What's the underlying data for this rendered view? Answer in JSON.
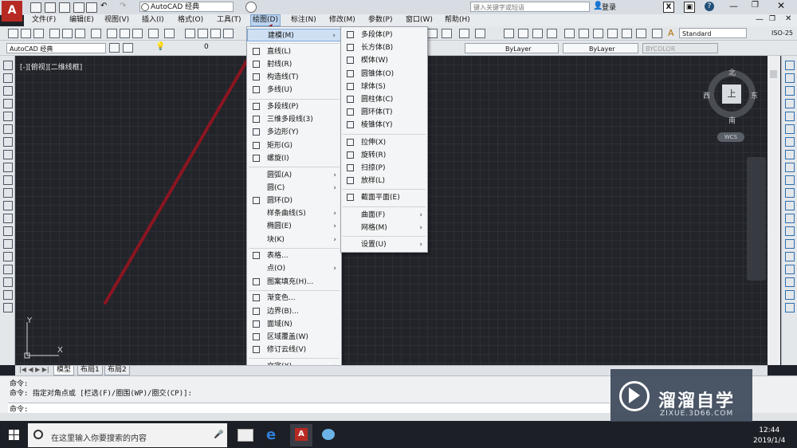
{
  "title_bar": {
    "workspace": "AutoCAD 经典",
    "search_placeholder": "键入关键字或短语",
    "login": "登录"
  },
  "menubar": [
    "文件(F)",
    "编辑(E)",
    "视图(V)",
    "插入(I)",
    "格式(O)",
    "工具(T)",
    "绘图(D)",
    "标注(N)",
    "修改(M)",
    "参数(P)",
    "窗口(W)",
    "帮助(H)"
  ],
  "toolbar2": {
    "workspace": "AutoCAD 经典",
    "layer": "0",
    "bylayer_color": "ByLayer",
    "bylayer_linetype": "ByLayer",
    "bycolor": "BYCOLOR",
    "text_style": "Standard",
    "dim_style": "ISO-25"
  },
  "viewport_label": "[-][俯视][二维线框]",
  "tabs": [
    "模型",
    "布局1",
    "布局2"
  ],
  "draw_menu": {
    "items": [
      {
        "label": "建模(M)",
        "submenu": true,
        "icon": "none"
      },
      {
        "sep": true
      },
      {
        "label": "直线(L)",
        "icon": "line-icon"
      },
      {
        "label": "射线(R)",
        "icon": "ray-icon"
      },
      {
        "label": "构造线(T)",
        "icon": "xline-icon"
      },
      {
        "label": "多线(U)",
        "icon": "mline-icon"
      },
      {
        "sep": true
      },
      {
        "label": "多段线(P)",
        "icon": "polyline-icon"
      },
      {
        "label": "三维多段线(3)",
        "icon": "3dpoly-icon"
      },
      {
        "label": "多边形(Y)",
        "icon": "polygon-icon"
      },
      {
        "label": "矩形(G)",
        "icon": "rectangle-icon"
      },
      {
        "label": "螺旋(I)",
        "icon": "helix-icon"
      },
      {
        "sep": true
      },
      {
        "label": "圆弧(A)",
        "submenu": true,
        "icon": "none"
      },
      {
        "label": "圆(C)",
        "submenu": true,
        "icon": "none"
      },
      {
        "label": "圆环(D)",
        "icon": "donut-icon"
      },
      {
        "label": "样条曲线(S)",
        "submenu": true,
        "icon": "none"
      },
      {
        "label": "椭圆(E)",
        "submenu": true,
        "icon": "none"
      },
      {
        "label": "块(K)",
        "submenu": true,
        "icon": "none"
      },
      {
        "sep": true
      },
      {
        "label": "表格...",
        "icon": "table-icon"
      },
      {
        "label": "点(O)",
        "submenu": true,
        "icon": "none"
      },
      {
        "label": "图案填充(H)...",
        "icon": "hatch-icon"
      },
      {
        "sep": true
      },
      {
        "label": "渐变色...",
        "icon": "gradient-icon"
      },
      {
        "label": "边界(B)...",
        "icon": "boundary-icon"
      },
      {
        "label": "面域(N)",
        "icon": "region-icon"
      },
      {
        "label": "区域覆盖(W)",
        "icon": "wipeout-icon"
      },
      {
        "label": "修订云线(V)",
        "icon": "revcloud-icon"
      },
      {
        "sep": true
      },
      {
        "label": "文字(X)",
        "submenu": true,
        "icon": "none"
      }
    ]
  },
  "modeling_submenu": {
    "items": [
      {
        "label": "多段体(P)",
        "icon": "polysolid-icon"
      },
      {
        "label": "长方体(B)",
        "icon": "box-icon"
      },
      {
        "label": "楔体(W)",
        "icon": "wedge-icon"
      },
      {
        "label": "圆锥体(O)",
        "icon": "cone-icon"
      },
      {
        "label": "球体(S)",
        "icon": "sphere-icon"
      },
      {
        "label": "圆柱体(C)",
        "icon": "cylinder-icon"
      },
      {
        "label": "圆环体(T)",
        "icon": "torus-icon"
      },
      {
        "label": "棱锥体(Y)",
        "icon": "pyramid-icon"
      },
      {
        "sep": true
      },
      {
        "label": "拉伸(X)",
        "icon": "extrude-icon"
      },
      {
        "label": "旋转(R)",
        "icon": "revolve-icon"
      },
      {
        "label": "扫掠(P)",
        "icon": "sweep-icon"
      },
      {
        "label": "放样(L)",
        "icon": "loft-icon"
      },
      {
        "sep": true
      },
      {
        "label": "截面平面(E)",
        "icon": "sectionplane-icon"
      },
      {
        "sep": true
      },
      {
        "label": "曲面(F)",
        "submenu": true,
        "icon": "none"
      },
      {
        "label": "网格(M)",
        "submenu": true,
        "icon": "none"
      },
      {
        "sep": true
      },
      {
        "label": "设置(U)",
        "submenu": true,
        "icon": "none"
      }
    ]
  },
  "compass": {
    "north": "北",
    "south": "南",
    "east": "东",
    "west": "西",
    "top": "上",
    "wcs": "WCS"
  },
  "command": {
    "line1": "命令:",
    "line2": "命令: 指定对角点或 [栏选(F)/圈围(WP)/圈交(CP)]:",
    "prompt": "命令:"
  },
  "taskbar": {
    "search": "在这里输入你要搜索的内容",
    "time": "12:44",
    "date": "2019/1/4"
  },
  "watermark": {
    "title": "溜溜自学",
    "subtitle": "ZIXUE.3D66.COM"
  },
  "ucs": {
    "x": "X",
    "y": "Y"
  },
  "colors": {
    "accent": "#7fa7d6",
    "arrow": "#8b1520",
    "canvas": "#222429"
  }
}
